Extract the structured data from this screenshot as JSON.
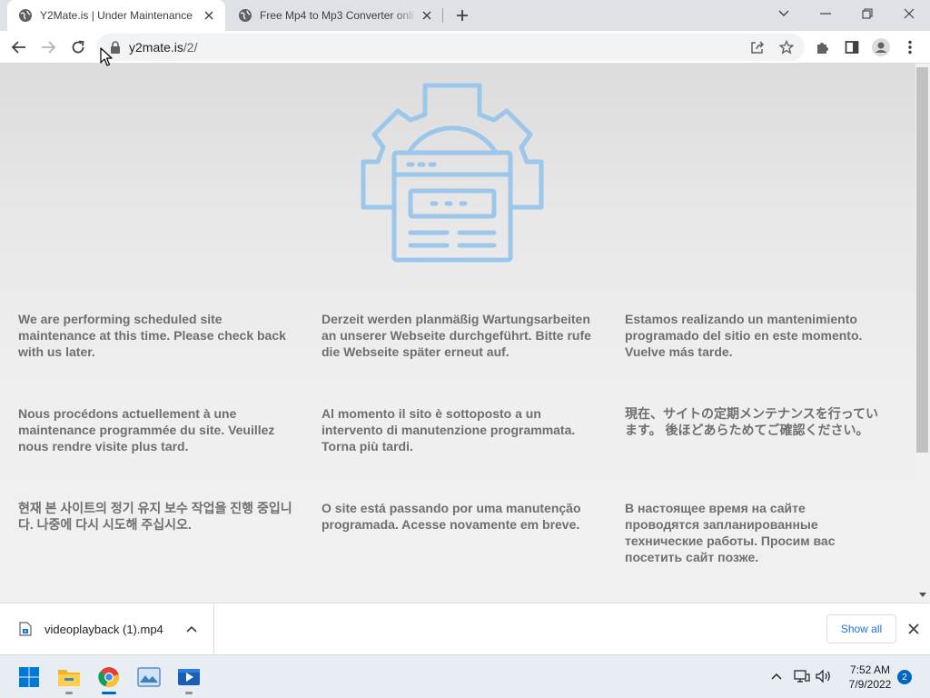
{
  "browser": {
    "tabs": [
      {
        "title": "Y2Mate.is | Under Maintenance",
        "active": true
      },
      {
        "title": "Free Mp4 to Mp3 Converter onli",
        "active": false
      }
    ],
    "address": {
      "host": "y2mate.is",
      "path": "/2/"
    }
  },
  "page": {
    "hero_icon": "gear-webpage-maintenance-icon",
    "messages": [
      {
        "lang": "en",
        "text": "We are performing scheduled site maintenance at this time. Please check back with us later."
      },
      {
        "lang": "de",
        "text": "Derzeit werden planmäßig Wartungsarbeiten an unserer Webseite durchgeführt. Bitte rufe die Webseite später erneut auf."
      },
      {
        "lang": "es",
        "text": "Estamos realizando un mantenimiento programado del sitio en este momento. Vuelve más tarde."
      },
      {
        "lang": "fr",
        "text": "Nous procédons actuellement à une maintenance programmée du site. Veuillez nous rendre visite plus tard."
      },
      {
        "lang": "it",
        "text": "Al momento il sito è sottoposto a un intervento di manutenzione programmata. Torna più tardi."
      },
      {
        "lang": "ja",
        "text": "現在、サイトの定期メンテナンスを行っています。 後ほどあらためてご確認ください。"
      },
      {
        "lang": "ko",
        "text": "현재 본 사이트의 정기 유지 보수 작업을 진행 중입니다. 나중에 다시 시도해 주십시오."
      },
      {
        "lang": "pt",
        "text": "O site está passando por uma manutenção programada. Acesse novamente em breve."
      },
      {
        "lang": "ru",
        "text": "В настоящее время на сайте проводятся запланированные технические работы. Просим вас посетить сайт позже."
      }
    ]
  },
  "downloads": {
    "item": {
      "filename": "videoplayback (1).mp4"
    },
    "show_all_label": "Show all"
  },
  "taskbar": {
    "apps": [
      "start-icon",
      "file-explorer-icon",
      "chrome-icon",
      "photos-icon",
      "media-player-icon"
    ],
    "clock": {
      "time": "7:52 AM",
      "date": "7/9/2022"
    },
    "notification_count": "2"
  },
  "colors": {
    "hero_blue": "#9cc6ea",
    "message_text": "#6f6f6f",
    "link_blue": "#1a73e8",
    "taskbar_accent": "#0067c0"
  }
}
